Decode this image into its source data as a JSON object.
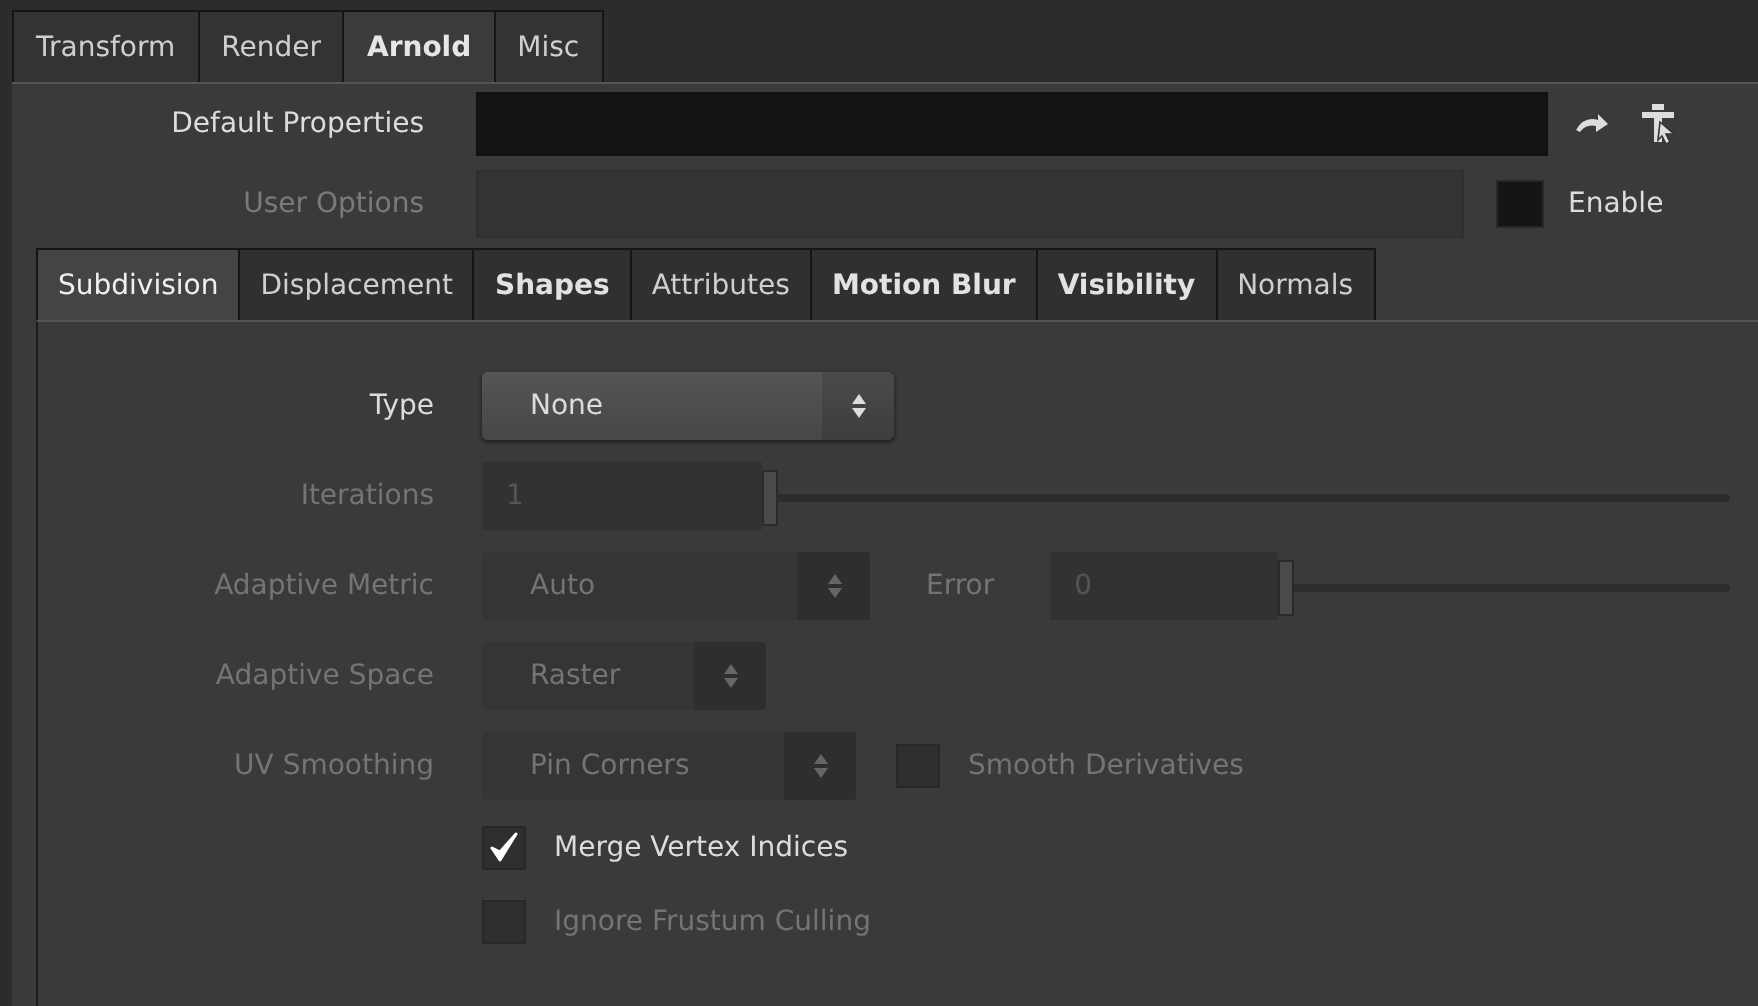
{
  "top_tabs": [
    {
      "label": "Transform",
      "selected": false
    },
    {
      "label": "Render",
      "selected": false
    },
    {
      "label": "Arnold",
      "selected": true
    },
    {
      "label": "Misc",
      "selected": false
    }
  ],
  "default_properties": {
    "label": "Default Properties"
  },
  "user_options": {
    "label": "User Options",
    "disabled": true
  },
  "enable": {
    "label": "Enable",
    "checked": false
  },
  "sub_tabs": [
    {
      "label": "Subdivision",
      "selected": true,
      "bold": false
    },
    {
      "label": "Displacement",
      "selected": false,
      "bold": false
    },
    {
      "label": "Shapes",
      "selected": false,
      "bold": true
    },
    {
      "label": "Attributes",
      "selected": false,
      "bold": false
    },
    {
      "label": "Motion Blur",
      "selected": false,
      "bold": true
    },
    {
      "label": "Visibility",
      "selected": false,
      "bold": true
    },
    {
      "label": "Normals",
      "selected": false,
      "bold": false
    }
  ],
  "parameters": [
    {
      "label": "Type",
      "disabled": false,
      "items": [
        {
          "kind": "menu",
          "value": "None"
        }
      ]
    },
    {
      "label": "Iterations",
      "disabled": true,
      "items": [
        {
          "kind": "slider",
          "value": "1",
          "level": 0
        }
      ]
    },
    {
      "label": "Adaptive Metric",
      "disabled": true,
      "items": [
        {
          "kind": "menu",
          "value": "Auto"
        },
        {
          "kind": "slider",
          "label": "Error",
          "value": "0",
          "level": 0
        }
      ]
    },
    {
      "label": "Adaptive Space",
      "disabled": true,
      "items": [
        {
          "kind": "menu",
          "value": "Raster"
        }
      ]
    },
    {
      "label": "UV Smoothing",
      "disabled": true,
      "items": [
        {
          "kind": "menu",
          "value": "Pin Corners"
        },
        {
          "kind": "checkbox",
          "label": "Smooth Derivatives",
          "checked": false
        }
      ]
    },
    {
      "disabled": false,
      "items": [
        {
          "kind": "checkbox",
          "label": "Merge Vertex Indices",
          "checked": true
        }
      ]
    },
    {
      "disabled": true,
      "items": [
        {
          "kind": "checkbox",
          "label": "Ignore Frustum Culling",
          "checked": false
        }
      ]
    }
  ]
}
